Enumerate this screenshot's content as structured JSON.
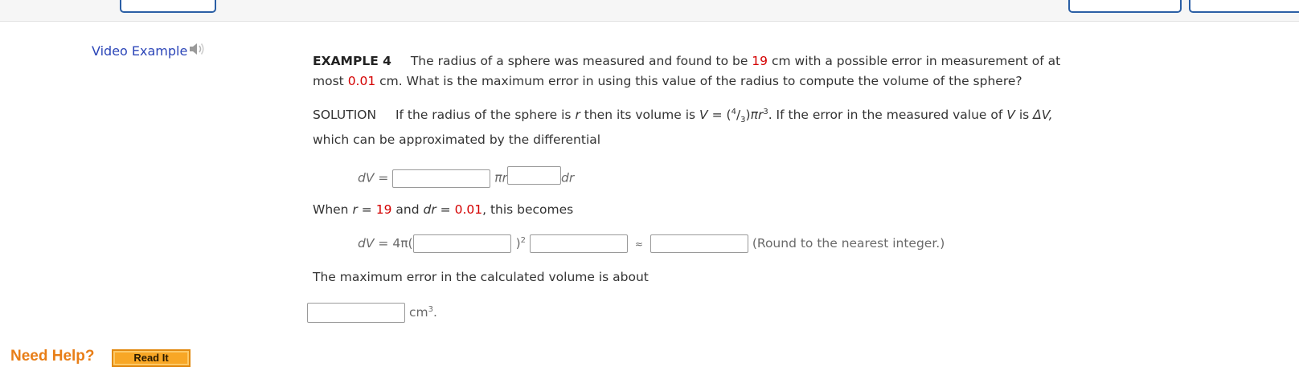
{
  "video_example": {
    "label": "Video Example",
    "icon": "speaker-icon"
  },
  "example": {
    "heading": "EXAMPLE 4",
    "text_a": "The radius of a sphere was measured and found to be",
    "radius": "19",
    "text_b": "cm with a possible error in measurement of at",
    "text_c": "most",
    "error": "0.01",
    "text_d": "cm. What is the maximum error in using this value of the radius to compute the volume of the sphere?"
  },
  "solution": {
    "label": "SOLUTION",
    "text_a": "If the radius of the sphere is",
    "r": "r",
    "text_b": "then its volume is",
    "V": "V",
    "eq": "=",
    "frac_num": "4",
    "frac_den": "3",
    "pi_r": "πr",
    "cube": "3",
    "text_c": ". If the error in the measured value of",
    "text_d": "is",
    "delta_v": "ΔV,",
    "line2": "which can be approximated by the differential"
  },
  "dv_line": {
    "lhs": "dV",
    "eq": "=",
    "pi_r": "πr",
    "dr": "dr",
    "input1_value": "",
    "input2_value": ""
  },
  "when_line": {
    "text_a": "When",
    "r": "r",
    "eq": "=",
    "r_value": "19",
    "and": "and",
    "dr": "dr",
    "dr_value": "0.01",
    "text_b": ", this becomes"
  },
  "dv4_line": {
    "lhs": "dV",
    "eq": "=",
    "four_pi": "4π(",
    "close_sq": ")",
    "sq": "2",
    "approx": "≈",
    "hint": "(Round to the nearest integer.)",
    "input1_value": "",
    "input2_value": "",
    "input3_value": ""
  },
  "conclusion": {
    "text": "The maximum error in the calculated volume is about"
  },
  "final": {
    "unit": "cm",
    "unit_exp": "3",
    "period": ".",
    "input_value": ""
  },
  "help": {
    "label": "Need Help?",
    "read_it": "Read It"
  },
  "colors": {
    "link": "#2c46b8",
    "highlight": "#d40000",
    "help": "#e87e17",
    "button": "#f8a726"
  }
}
